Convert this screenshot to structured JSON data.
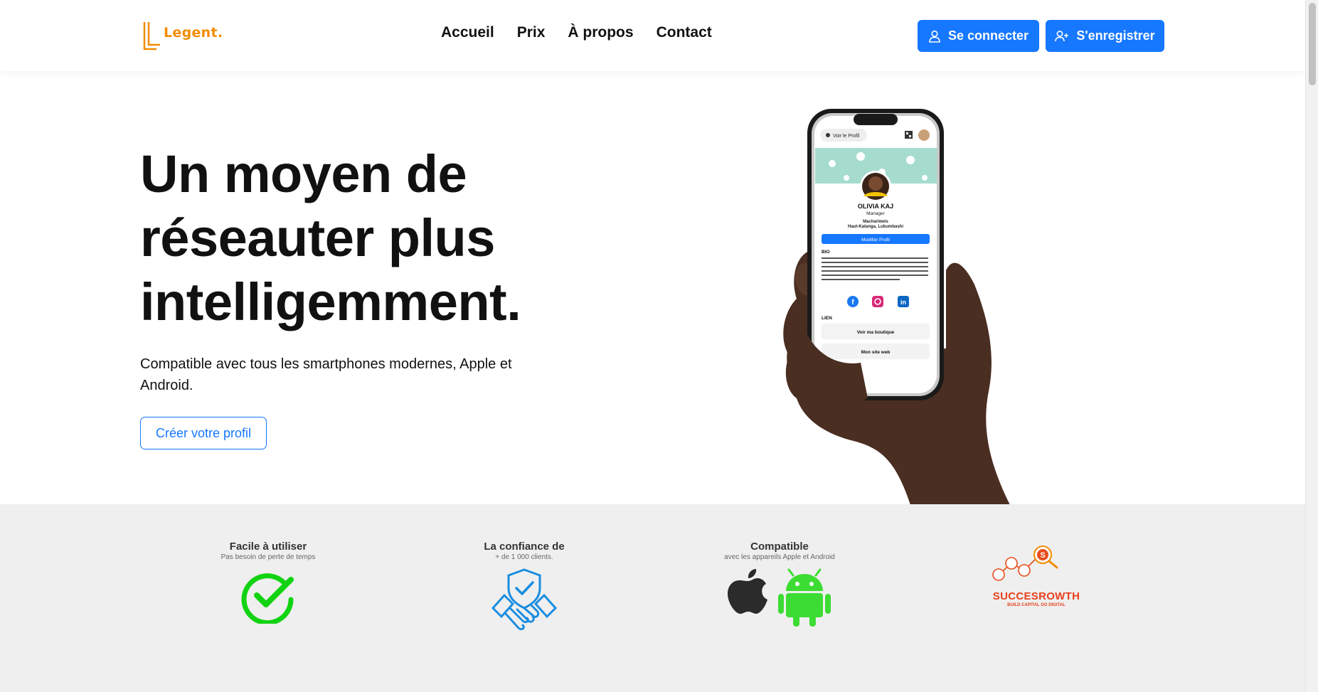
{
  "brand": {
    "name": "Legent.",
    "color": "#f28c00"
  },
  "nav": {
    "items": [
      "Accueil",
      "Prix",
      "À propos",
      "Contact"
    ]
  },
  "auth": {
    "login_label": "Se connecter",
    "register_label": "S'enregistrer",
    "accent": "#1677ff"
  },
  "hero": {
    "title_line1": "Un moyen de",
    "title_line2": "réseauter plus",
    "title_line3": "intelligemment.",
    "subtitle": "Compatible avec tous les smartphones modernes, Apple et Android.",
    "cta_label": "Créer votre profil"
  },
  "phone": {
    "top_label": "Voir le Profil",
    "name": "OLIVIA KAJ",
    "role": "Manager",
    "company": "Macharlewis",
    "location": "Haut-Katanga, Lubumbashi",
    "edit_button": "Modifier Profil",
    "bio_heading": "BIO",
    "bio_text": "Responsable marketing chez Macharlewis. J'assume par la stratégie de marque et les campagnes innovantes. Avec une formation en marketing et un sens aigu de la consommation, j'apporte une grande expérience à l'équipe.",
    "links_heading": "LIEN",
    "link1": "Voir ma boutique",
    "link2": "Mon site web"
  },
  "features": [
    {
      "title": "Facile à utiliser",
      "subtitle": "Pas besoin de perte de temps",
      "icon": "check-circle-icon"
    },
    {
      "title": "La confiance de",
      "subtitle": "+ de 1 000 clients.",
      "icon": "handshake-shield-icon"
    },
    {
      "title": "Compatible",
      "subtitle": "avec les appareils Apple et Android",
      "icon": "apple-android-icon"
    }
  ],
  "partner": {
    "name": "SUCCESROWTH",
    "tagline": "BUILD CAPITAL GO DIGITAL"
  }
}
